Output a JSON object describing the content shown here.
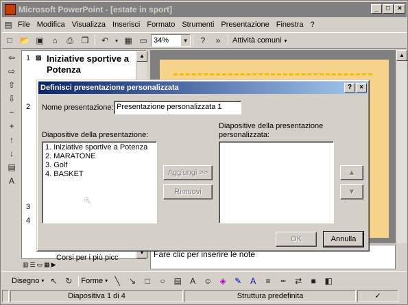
{
  "window": {
    "title": "Microsoft PowerPoint - [estate in sport]"
  },
  "menu": [
    "File",
    "Modifica",
    "Visualizza",
    "Inserisci",
    "Formato",
    "Strumenti",
    "Presentazione",
    "Finestra",
    "?"
  ],
  "toolbar": {
    "zoom": "34%",
    "activities": "Attività comuni"
  },
  "outline": {
    "slide1_num": "1",
    "slide1_title": "Iniziative sportive a Potenza",
    "slide2_num": "2",
    "slide3_num": "3",
    "slide4_num": "4",
    "bullet_text": "Corsi per i più picc"
  },
  "notes": {
    "placeholder": "Fare clic per inserire le note"
  },
  "drawbar": {
    "draw": "Disegno",
    "shapes": "Forme"
  },
  "status": {
    "slide": "Diapositiva 1 di 4",
    "design": "Struttura predefinita"
  },
  "dialog": {
    "title": "Definisci presentazione personalizzata",
    "name_label": "Nome presentazione:",
    "name_value": "Presentazione personalizzata 1",
    "left_label": "Diapositive della presentazione:",
    "right_label_line1": "Diapositive della presentazione",
    "right_label_line2": "personalizzata:",
    "slides": [
      "1. Iniziative sportive a Potenza",
      "2. MARATONE",
      "3. Golf",
      "4. BASKET"
    ],
    "add_button": "Aggiungi >>",
    "remove_button": "Rimuovi",
    "ok_button": "OK",
    "cancel_button": "Annulla"
  }
}
